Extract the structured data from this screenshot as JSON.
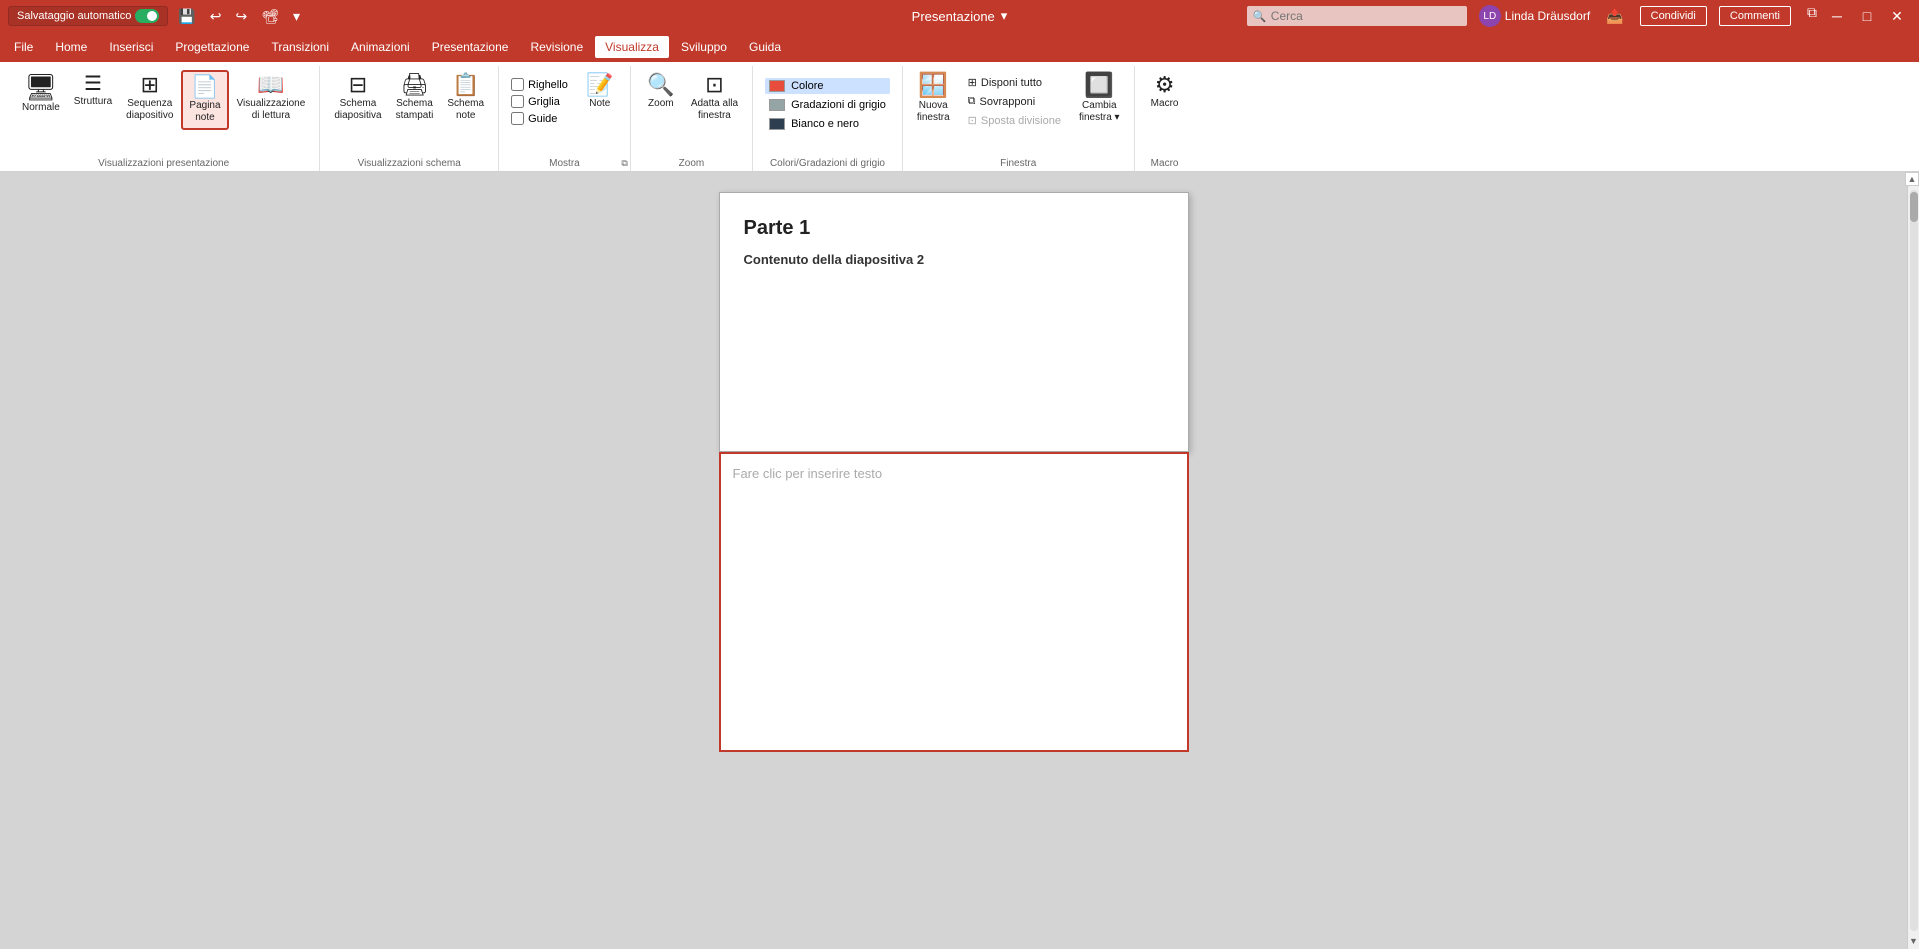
{
  "titlebar": {
    "autosave_label": "Salvataggio automatico",
    "autosave_on": true,
    "title": "Presentazione",
    "user_name": "Linda Dräusdorf",
    "user_initials": "LD",
    "search_placeholder": "Cerca"
  },
  "menubar": {
    "items": [
      {
        "id": "file",
        "label": "File"
      },
      {
        "id": "home",
        "label": "Home"
      },
      {
        "id": "inserisci",
        "label": "Inserisci"
      },
      {
        "id": "progettazione",
        "label": "Progettazione"
      },
      {
        "id": "transizioni",
        "label": "Transizioni"
      },
      {
        "id": "animazioni",
        "label": "Animazioni"
      },
      {
        "id": "presentazione",
        "label": "Presentazione"
      },
      {
        "id": "revisione",
        "label": "Revisione"
      },
      {
        "id": "visualizza",
        "label": "Visualizza",
        "active": true
      },
      {
        "id": "sviluppo",
        "label": "Sviluppo"
      },
      {
        "id": "guida",
        "label": "Guida"
      }
    ]
  },
  "ribbon": {
    "groups": {
      "visualizzazioni_presentazione": {
        "label": "Visualizzazioni presentazione",
        "buttons": [
          {
            "id": "normale",
            "label": "Normale",
            "icon": "🖥"
          },
          {
            "id": "struttura",
            "label": "Struttura",
            "icon": "☰"
          },
          {
            "id": "sequenza",
            "label": "Sequenza\ndiapositivo",
            "icon": "⊞"
          },
          {
            "id": "pagina_note",
            "label": "Pagina\nnote",
            "icon": "📄",
            "active": true
          },
          {
            "id": "vis_lettura",
            "label": "Visualizzazione\ndi lettura",
            "icon": "📖"
          }
        ]
      },
      "visualizzazioni_schema": {
        "label": "Visualizzazioni schema",
        "buttons": [
          {
            "id": "schema_diapositiva",
            "label": "Schema\ndiapositiva",
            "icon": "⊟"
          },
          {
            "id": "schema_stampati",
            "label": "Schema\nstampati",
            "icon": "🖨"
          },
          {
            "id": "schema_note",
            "label": "Schema\nnote",
            "icon": "📋"
          }
        ]
      },
      "mostra": {
        "label": "Mostra",
        "checkboxes": [
          {
            "id": "righello",
            "label": "Righello",
            "checked": false
          },
          {
            "id": "griglia",
            "label": "Griglia",
            "checked": false
          },
          {
            "id": "guide",
            "label": "Guide",
            "checked": false
          }
        ],
        "buttons": [
          {
            "id": "note",
            "label": "Note",
            "icon": "📝"
          }
        ]
      },
      "zoom": {
        "label": "Zoom",
        "buttons": [
          {
            "id": "zoom_btn",
            "label": "Zoom",
            "icon": "🔍"
          },
          {
            "id": "adatta_finestra",
            "label": "Adatta alla\nfinestra",
            "icon": "⊡"
          }
        ]
      },
      "colori_gradazioni": {
        "label": "Colori/Gradazioni di grigio",
        "items": [
          {
            "id": "colore",
            "label": "Colore",
            "color": "#e74c3c",
            "active": true
          },
          {
            "id": "gradazioni_grigio",
            "label": "Gradazioni di grigio",
            "color": "#95a5a6"
          },
          {
            "id": "bianco_nero",
            "label": "Bianco e nero",
            "color": "#2c3e50"
          }
        ]
      },
      "finestra": {
        "label": "Finestra",
        "tall_btn": {
          "id": "nuova_finestra",
          "label": "Nuova\nfinestra",
          "icon": "🪟"
        },
        "small_btns": [
          {
            "id": "disponi_tutto",
            "label": "Disponi tutto"
          },
          {
            "id": "sovrapponi",
            "label": "Sovrapponi"
          },
          {
            "id": "sposta_divisione",
            "label": "Sposta divisione",
            "disabled": true
          },
          {
            "id": "cambia_finestra",
            "label": "Cambia\nfinestra",
            "has_arrow": true
          }
        ]
      },
      "macro": {
        "label": "Macro",
        "buttons": [
          {
            "id": "macro_btn",
            "label": "Macro",
            "icon": "⚙"
          }
        ]
      }
    }
  },
  "slide": {
    "title": "Parte 1",
    "content": "Contenuto della diapositiva 2"
  },
  "notes": {
    "placeholder": "Fare clic per inserire testo"
  },
  "share_btn": "Condividi",
  "comments_btn": "Commenti"
}
